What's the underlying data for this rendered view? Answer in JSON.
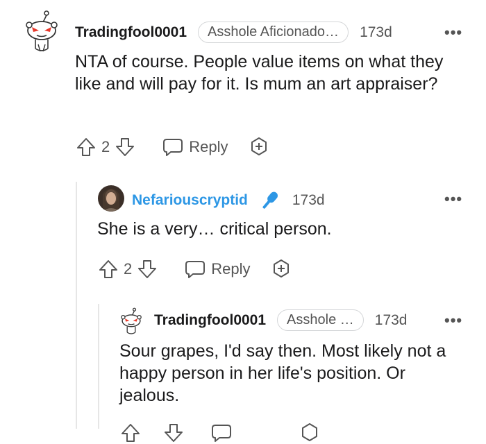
{
  "comments": [
    {
      "username": "Tradingfool0001",
      "flair": "Asshole Aficionado…",
      "time": "173d",
      "more": "•••",
      "text": "NTA of course. People value items on what they like and will pay for it. Is mum an art appraiser?",
      "votes": "2",
      "reply_label": "Reply"
    },
    {
      "username": "Nefariouscryptid",
      "flair": "",
      "time": "173d",
      "more": "•••",
      "text": "She is a very… critical person.",
      "votes": "2",
      "reply_label": "Reply"
    },
    {
      "username": "Tradingfool0001",
      "flair": "Asshole …",
      "time": "173d",
      "more": "•••",
      "text": "Sour grapes, I'd say then. Most likely not a happy person in her life's position. Or jealous.",
      "votes": "",
      "reply_label": ""
    }
  ],
  "colors": {
    "op_username": "#2d97e5",
    "text": "#1a1a1b",
    "muted": "#555555",
    "snoo_eye": "#e8392b"
  }
}
